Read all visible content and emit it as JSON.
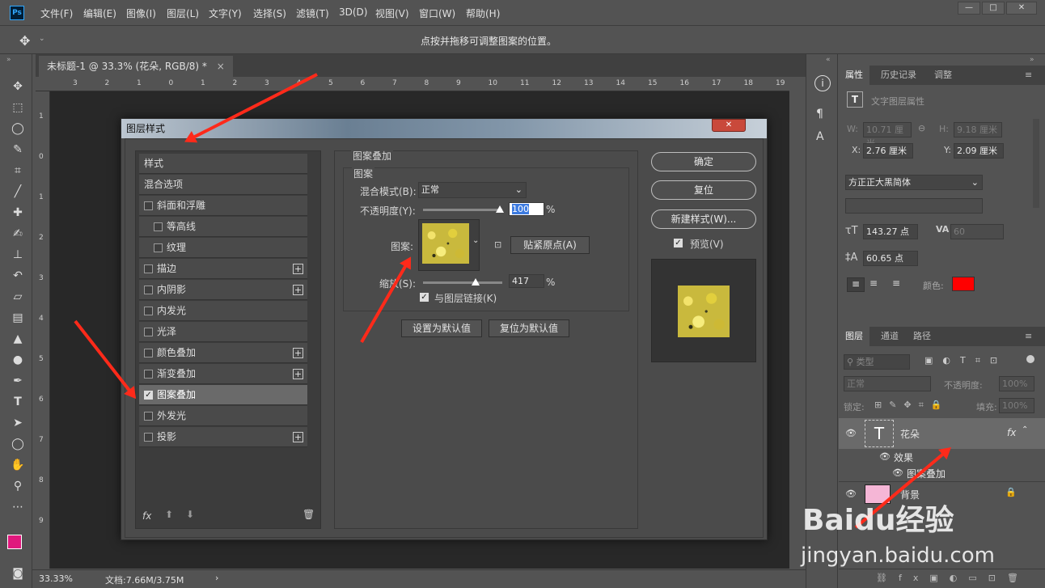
{
  "app": {
    "logo": "Ps"
  },
  "menu": [
    "文件(F)",
    "编辑(E)",
    "图像(I)",
    "图层(L)",
    "文字(Y)",
    "选择(S)",
    "滤镜(T)",
    "3D(D)",
    "视图(V)",
    "窗口(W)",
    "帮助(H)"
  ],
  "window_buttons": {
    "min": "—",
    "max": "□",
    "close": "✕"
  },
  "options_bar": {
    "hint": "点按并拖移可调整图案的位置。"
  },
  "document": {
    "tab_title": "未标题-1 @ 33.3% (花朵, RGB/8) *",
    "tab_close": "×"
  },
  "ruler": {
    "h_ticks": [
      "3",
      "2",
      "1",
      "0",
      "1",
      "2",
      "3",
      "4",
      "5",
      "6",
      "7",
      "8",
      "9",
      "10",
      "11",
      "12",
      "13",
      "14",
      "15",
      "16",
      "17",
      "18",
      "19"
    ],
    "v_ticks": [
      "1",
      "0",
      "1",
      "2",
      "3",
      "4",
      "5",
      "6",
      "7",
      "8",
      "9"
    ]
  },
  "status": {
    "zoom": "33.33%",
    "doc": "文档:7.66M/3.75M",
    "arrow": "›"
  },
  "dialog": {
    "title": "图层样式",
    "close": "✕",
    "styles_header": "样式",
    "blend_options": "混合选项",
    "styles": [
      {
        "label": "斜面和浮雕",
        "checked": false,
        "plus": false,
        "indent": false
      },
      {
        "label": "等高线",
        "checked": false,
        "plus": false,
        "indent": true
      },
      {
        "label": "纹理",
        "checked": false,
        "plus": false,
        "indent": true
      },
      {
        "label": "描边",
        "checked": false,
        "plus": true,
        "indent": false
      },
      {
        "label": "内阴影",
        "checked": false,
        "plus": true,
        "indent": false
      },
      {
        "label": "内发光",
        "checked": false,
        "plus": false,
        "indent": false
      },
      {
        "label": "光泽",
        "checked": false,
        "plus": false,
        "indent": false
      },
      {
        "label": "颜色叠加",
        "checked": false,
        "plus": true,
        "indent": false
      },
      {
        "label": "渐变叠加",
        "checked": false,
        "plus": true,
        "indent": false
      },
      {
        "label": "图案叠加",
        "checked": true,
        "plus": false,
        "indent": false
      },
      {
        "label": "外发光",
        "checked": false,
        "plus": false,
        "indent": false
      },
      {
        "label": "投影",
        "checked": false,
        "plus": true,
        "indent": false
      }
    ],
    "footer_fx": "fx",
    "section_title": "图案叠加",
    "group_title": "图案",
    "blend_mode_label": "混合模式(B):",
    "blend_mode_value": "正常",
    "opacity_label": "不透明度(Y):",
    "opacity_value": "100",
    "percent": "%",
    "pattern_label": "图案:",
    "snap_button": "贴紧原点(A)",
    "scale_label": "缩放(S):",
    "scale_value": "417",
    "link_label": "与图层链接(K)",
    "set_default": "设置为默认值",
    "reset_default": "复位为默认值",
    "ok": "确定",
    "reset": "复位",
    "new_style": "新建样式(W)...",
    "preview": "预览(V)"
  },
  "properties": {
    "tabs": [
      "属性",
      "历史记录",
      "调整"
    ],
    "type_title": "文字图层属性",
    "w_label": "W:",
    "w_value": "10.71 厘米",
    "h_label": "H:",
    "h_value": "9.18 厘米",
    "x_label": "X:",
    "x_value": "2.76 厘米",
    "y_label": "Y:",
    "y_value": "2.09 厘米",
    "font": "方正正大黑简体",
    "size": "143.27 点",
    "tracking": "60",
    "leading": "60.65 点",
    "color_label": "颜色:",
    "color": "#ff0000"
  },
  "layers": {
    "tabs": [
      "图层",
      "通道",
      "路径"
    ],
    "filter": "类型",
    "blend": "正常",
    "opacity_label": "不透明度:",
    "opacity": "100%",
    "lock_label": "锁定:",
    "fill_label": "填充:",
    "fill": "100%",
    "items": [
      {
        "name": "花朵",
        "type": "text",
        "fx": "fx"
      },
      {
        "name": "效果",
        "type": "effect"
      },
      {
        "name": "图案叠加",
        "type": "effect-item"
      },
      {
        "name": "背景",
        "type": "background"
      }
    ]
  },
  "watermark": {
    "brand": "Baidu经验",
    "url": "jingyan.baidu.com"
  }
}
